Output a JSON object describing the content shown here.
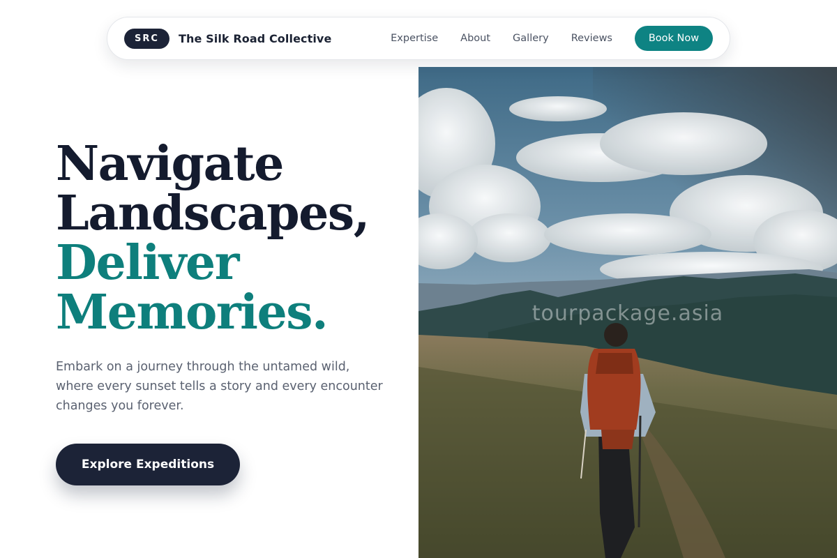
{
  "navbar": {
    "badge": "SRC",
    "brand_name": "The Silk Road Collective",
    "links": [
      "Expertise",
      "About",
      "Gallery",
      "Reviews"
    ],
    "cta_label": "Book Now"
  },
  "hero": {
    "title_line1": "Navigate",
    "title_line2": "Landscapes,",
    "title_line3": "Deliver",
    "title_line4": "Memories.",
    "subtitle": "Embark on a journey through the untamed wild, where every sunset tells a story and every encounter changes you forever.",
    "cta_label": "Explore Expeditions",
    "image": {
      "description_icon": "hiker-mountain-photo",
      "watermark": "tourpackage.asia"
    }
  },
  "colors": {
    "primary_dark": "#1c2337",
    "accent_teal": "#0e8383",
    "heading_teal": "#0e7f7c",
    "body_text": "#5a6170"
  }
}
